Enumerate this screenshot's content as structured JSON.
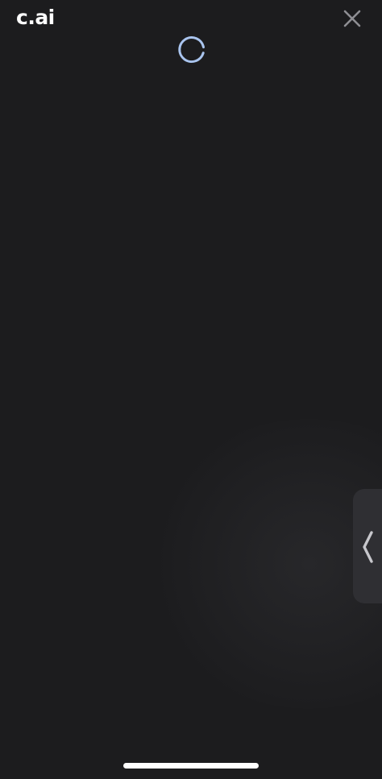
{
  "app": {
    "logo_text": "c.ai",
    "background_color": "#1c1c1e",
    "accent_color": "#a9c4ee"
  },
  "header": {
    "logo": "c.ai",
    "close_icon": "close-icon"
  },
  "main": {
    "loading_indicator": "spinner-icon"
  },
  "side_panel": {
    "toggle_icon": "chevron-left-icon"
  },
  "system": {
    "home_indicator": "home-indicator"
  }
}
